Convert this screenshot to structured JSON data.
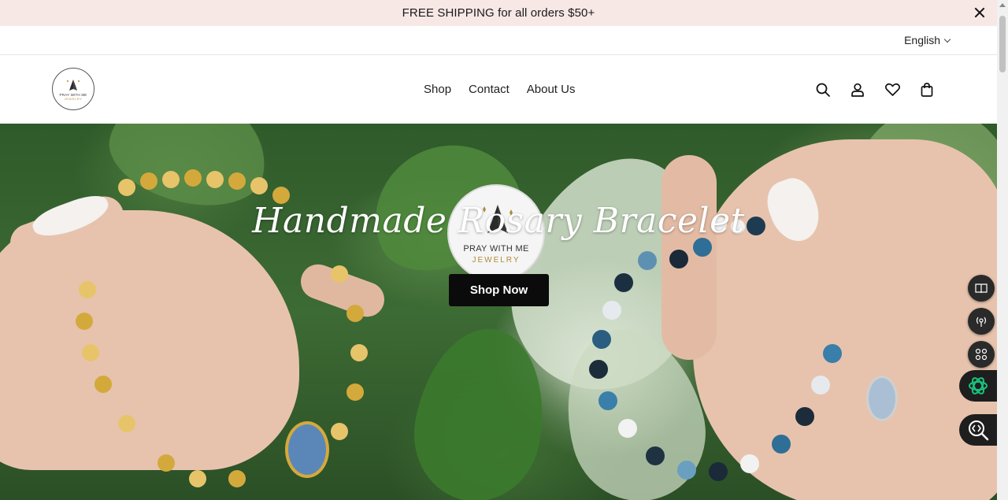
{
  "announcement": {
    "text": "FREE SHIPPING for all orders $50+"
  },
  "utility": {
    "language": "English"
  },
  "header": {
    "logo": {
      "line1": "PRAY WITH ME",
      "line2": "JEWELRY"
    },
    "nav": [
      {
        "label": "Shop"
      },
      {
        "label": "Contact"
      },
      {
        "label": "About Us"
      }
    ],
    "icons": [
      "search-icon",
      "account-icon",
      "wishlist-icon",
      "cart-icon"
    ]
  },
  "hero": {
    "title": "Handmade Rosary Bracelet",
    "logo": {
      "line1": "PRAY WITH ME",
      "line2": "JEWELRY"
    },
    "button": "Shop Now"
  },
  "widgets": [
    "book-icon",
    "radio-icon",
    "apps-icon",
    "ai-assistant-icon",
    "code-search-icon"
  ],
  "colors": {
    "announcement_bg": "#f7e8e6",
    "button_bg": "#0b0b0b",
    "accent_gold": "#b08a3a",
    "ai_green": "#19c37d"
  }
}
